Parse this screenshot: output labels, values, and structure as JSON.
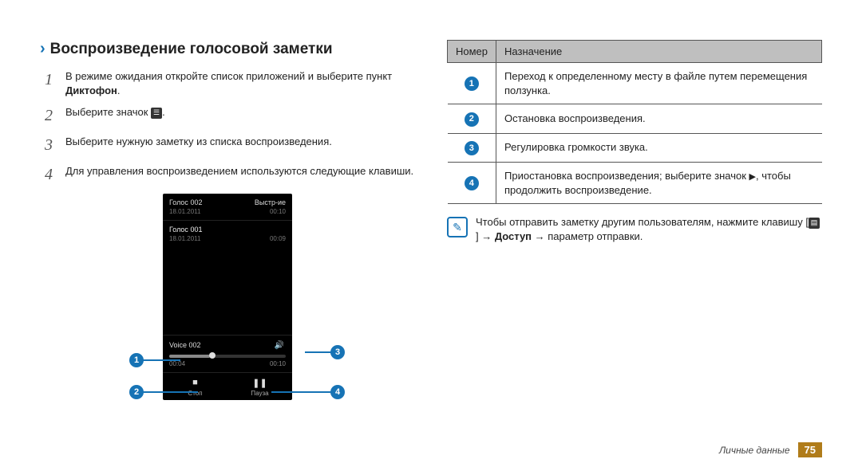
{
  "heading": "Воспроизведение голосовой заметки",
  "steps": [
    {
      "num": "1",
      "pre": "В режиме ожидания откройте список приложений и выберите пункт ",
      "bold": "Диктофон",
      "post": "."
    },
    {
      "num": "2",
      "pre": "Выберите значок ",
      "icon": "list-icon",
      "post": "."
    },
    {
      "num": "3",
      "pre": "Выберите нужную заметку из списка воспроизведения."
    },
    {
      "num": "4",
      "pre": "Для управления воспроизведением используются следующие клавиши."
    }
  ],
  "phone": {
    "header_title": "Голос 002",
    "header_action": "Выстр-ие",
    "header_date": "18.01.2011",
    "header_dur": "00:10",
    "row_title": "Голос 001",
    "row_date": "18.01.2011",
    "row_dur": "00:09",
    "player_title": "Voice 002",
    "time_elapsed": "00:04",
    "time_total": "00:10",
    "btn_stop": "■",
    "btn_stop_label": "Стоп",
    "btn_pause": "❚❚",
    "btn_pause_label": "Пауза"
  },
  "table": {
    "col1": "Номер",
    "col2": "Назначение",
    "rows": [
      {
        "n": "1",
        "text": "Переход к определенному месту в файле путем перемещения ползунка."
      },
      {
        "n": "2",
        "text": "Остановка воспроизведения."
      },
      {
        "n": "3",
        "text": "Регулировка громкости звука."
      },
      {
        "n": "4",
        "pre": "Приостановка воспроизведения; выберите значок ",
        "glyph": "▶",
        "post": ", чтобы продолжить воспроизведение."
      }
    ]
  },
  "note": {
    "pre": "Чтобы отправить заметку другим пользователям, нажмите клавишу [",
    "icon": "menu-icon",
    "mid": "] → ",
    "bold1": "Доступ",
    "post": " → параметр отправки."
  },
  "footer": {
    "label": "Личные данные",
    "page": "75"
  }
}
